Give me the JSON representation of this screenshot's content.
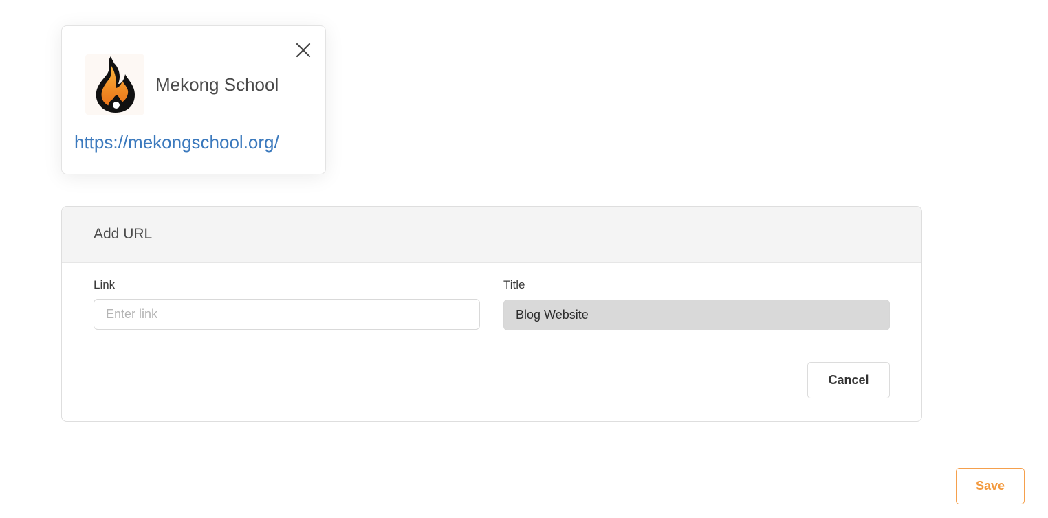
{
  "link_preview": {
    "title": "Mekong School",
    "url": "https://mekongschool.org/",
    "logo_icon": "flame-logo-icon",
    "close_icon": "close-icon"
  },
  "add_url_panel": {
    "title": "Add URL",
    "link_label": "Link",
    "link_placeholder": "Enter link",
    "link_value": "",
    "title_label": "Title",
    "title_value": "Blog Website",
    "cancel_label": "Cancel"
  },
  "save_label": "Save",
  "colors": {
    "link": "#3b79bd",
    "accent": "#f39a3f",
    "panel_header_bg": "#f4f4f4",
    "disabled_input_bg": "#d9d9d9"
  }
}
